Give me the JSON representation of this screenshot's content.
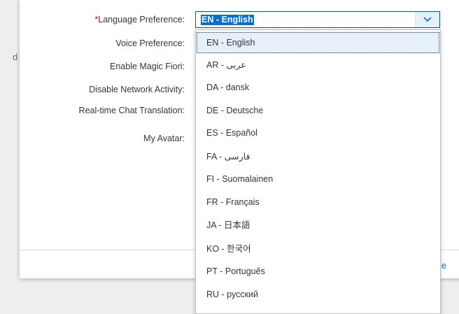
{
  "form": {
    "required_marker": "*",
    "language_label": "Language Preference:",
    "voice_label": "Voice Preference:",
    "magic_label": "Enable Magic Fiori:",
    "network_label": "Disable Network Activity:",
    "chat_label": "Real-time Chat Translation:",
    "avatar_label": "My Avatar:"
  },
  "language_select": {
    "value": "EN - English",
    "arrow_icon": "chevron-down-icon",
    "options": [
      "EN - English",
      "AR - عربى",
      "DA - dansk",
      "DE - Deutsche",
      "ES - Español",
      "FA - فارسی",
      "FI - Suomalainen",
      "FR - Français",
      "JA - 日本語",
      "KO - 한국어",
      "PT - Português",
      "RU - русский"
    ]
  },
  "background": {
    "footer_text": "e",
    "edge_glyph": "d"
  },
  "colors": {
    "accent": "#0a6ed1",
    "required": "#bb0000",
    "selected_option_bg": "#e5f0fa"
  }
}
